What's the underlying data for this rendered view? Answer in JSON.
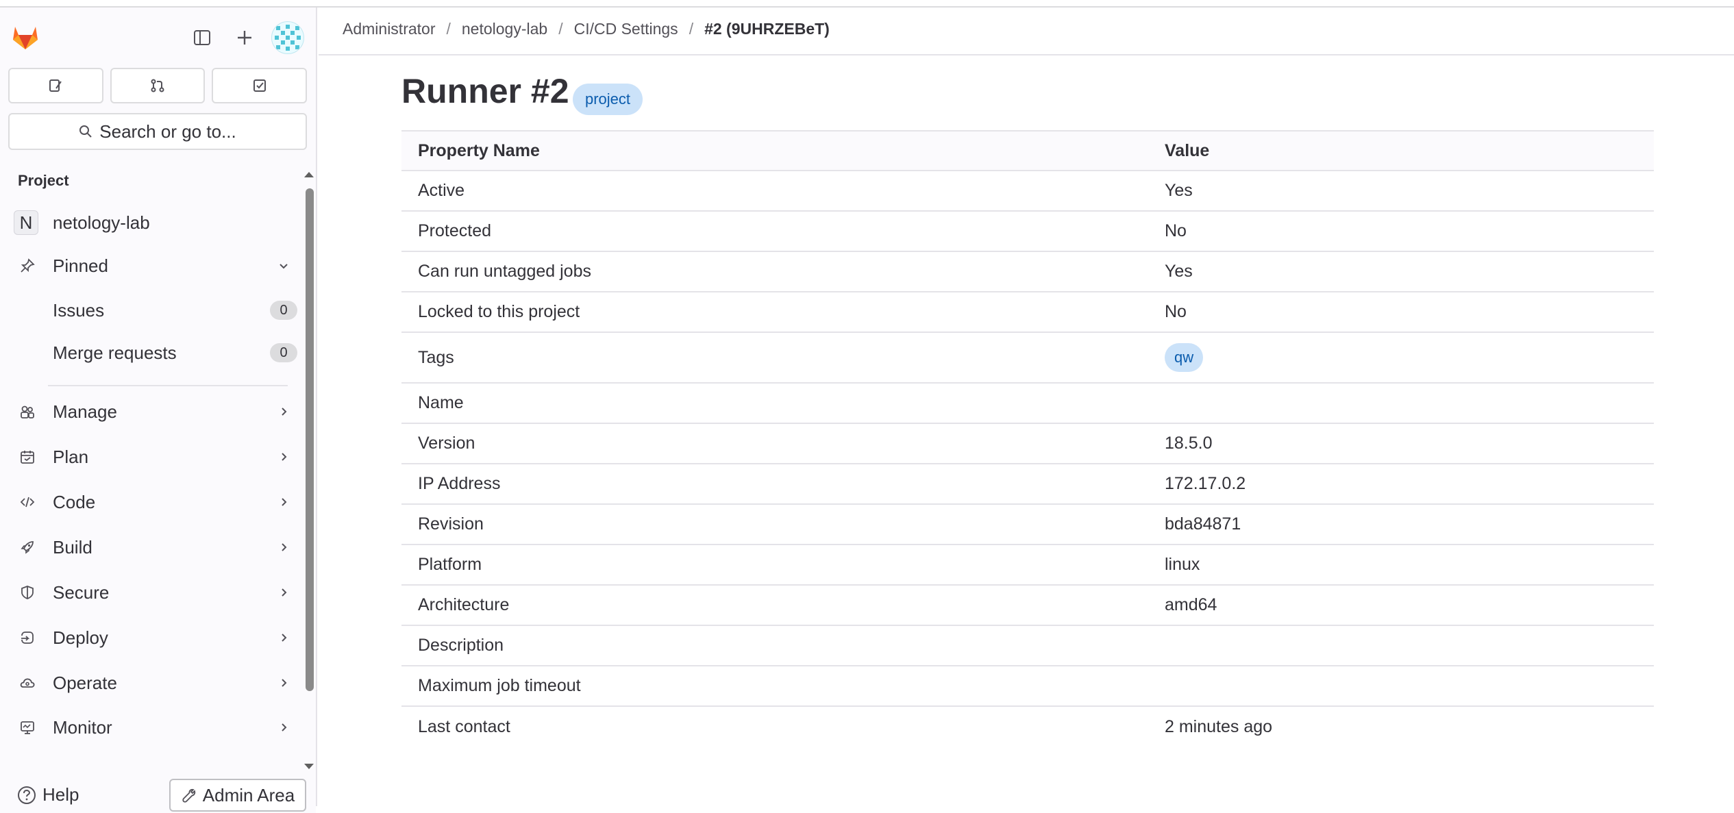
{
  "sidebar": {
    "search_label": "Search or go to...",
    "section_title": "Project",
    "project": {
      "letter": "N",
      "name": "netology-lab"
    },
    "pinned_label": "Pinned",
    "pinned_items": [
      {
        "label": "Issues",
        "count": "0"
      },
      {
        "label": "Merge requests",
        "count": "0"
      }
    ],
    "nav": [
      {
        "label": "Manage",
        "icon": "users-icon"
      },
      {
        "label": "Plan",
        "icon": "calendar-icon"
      },
      {
        "label": "Code",
        "icon": "code-icon"
      },
      {
        "label": "Build",
        "icon": "rocket-icon"
      },
      {
        "label": "Secure",
        "icon": "shield-icon"
      },
      {
        "label": "Deploy",
        "icon": "deploy-icon"
      },
      {
        "label": "Operate",
        "icon": "cloud-gear-icon"
      },
      {
        "label": "Monitor",
        "icon": "monitor-icon"
      }
    ],
    "help_label": "Help",
    "admin_label": "Admin Area"
  },
  "breadcrumb": [
    "Administrator",
    "netology-lab",
    "CI/CD Settings",
    "#2 (9UHRZEBeT)"
  ],
  "page": {
    "title": "Runner #2",
    "badge": "project"
  },
  "table": {
    "headers": [
      "Property Name",
      "Value"
    ],
    "rows": [
      {
        "name": "Active",
        "value": "Yes"
      },
      {
        "name": "Protected",
        "value": "No"
      },
      {
        "name": "Can run untagged jobs",
        "value": "Yes"
      },
      {
        "name": "Locked to this project",
        "value": "No"
      },
      {
        "name": "Tags",
        "value": "qw"
      },
      {
        "name": "Name",
        "value": ""
      },
      {
        "name": "Version",
        "value": "18.5.0"
      },
      {
        "name": "IP Address",
        "value": "172.17.0.2"
      },
      {
        "name": "Revision",
        "value": "bda84871"
      },
      {
        "name": "Platform",
        "value": "linux"
      },
      {
        "name": "Architecture",
        "value": "amd64"
      },
      {
        "name": "Description",
        "value": ""
      },
      {
        "name": "Maximum job timeout",
        "value": ""
      },
      {
        "name": "Last contact",
        "value": "2 minutes ago"
      }
    ]
  },
  "colors": {
    "accent": "#0b5cad",
    "badge_bg": "#cbe2f9",
    "logo_orange": "#fc6d26"
  }
}
